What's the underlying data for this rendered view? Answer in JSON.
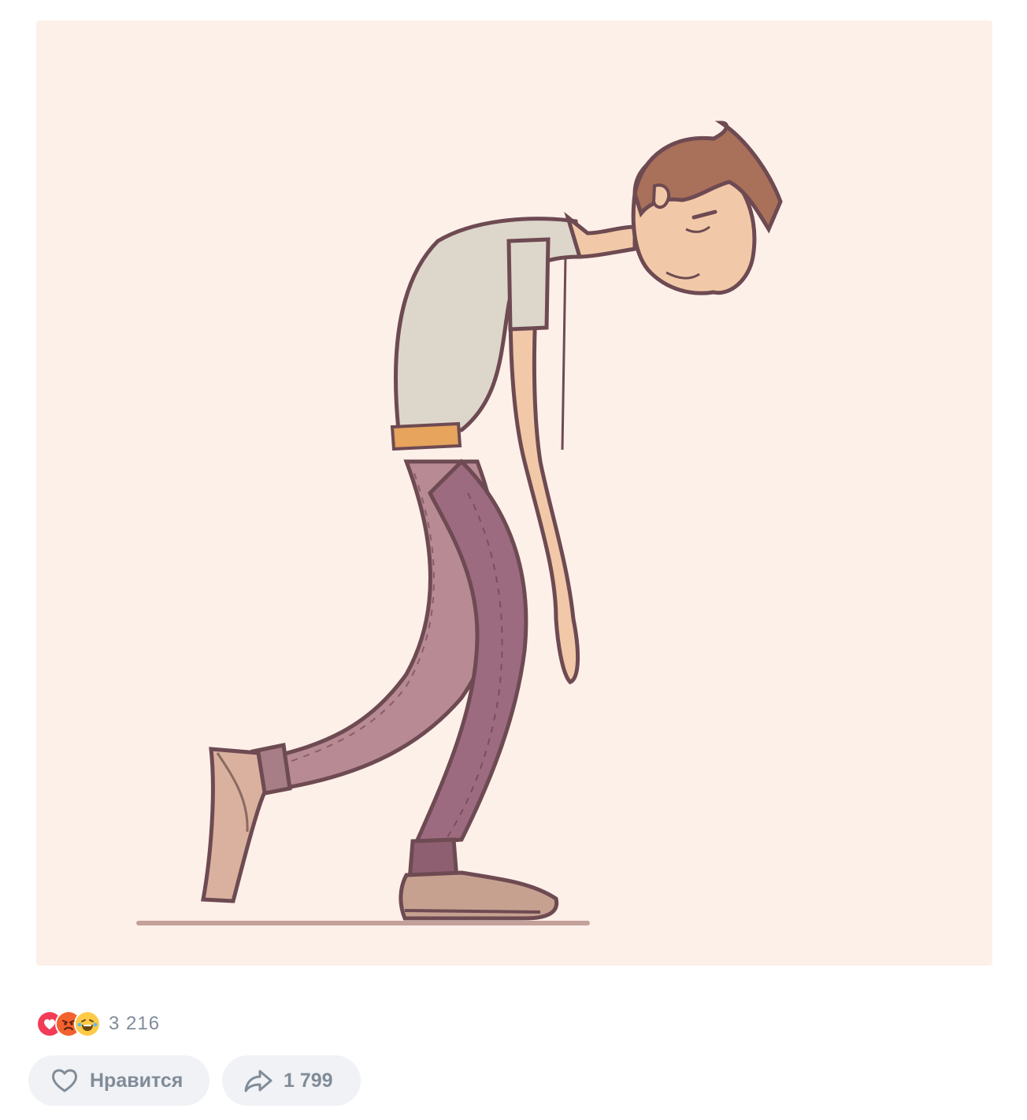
{
  "post": {
    "media": {
      "type": "animation",
      "background_color": "#fcf0e9"
    },
    "reactions": {
      "icons": [
        "heart-reaction",
        "angry-reaction",
        "laughing-reaction"
      ],
      "count": "3 216"
    },
    "actions": {
      "like_label": "Нравится",
      "share_count": "1 799"
    }
  },
  "colors": {
    "heart": "#f23c57",
    "angry": "#f2622e",
    "laugh": "#ffcb47",
    "muted_text": "#818c99",
    "button_bg": "#f0f2f5"
  }
}
